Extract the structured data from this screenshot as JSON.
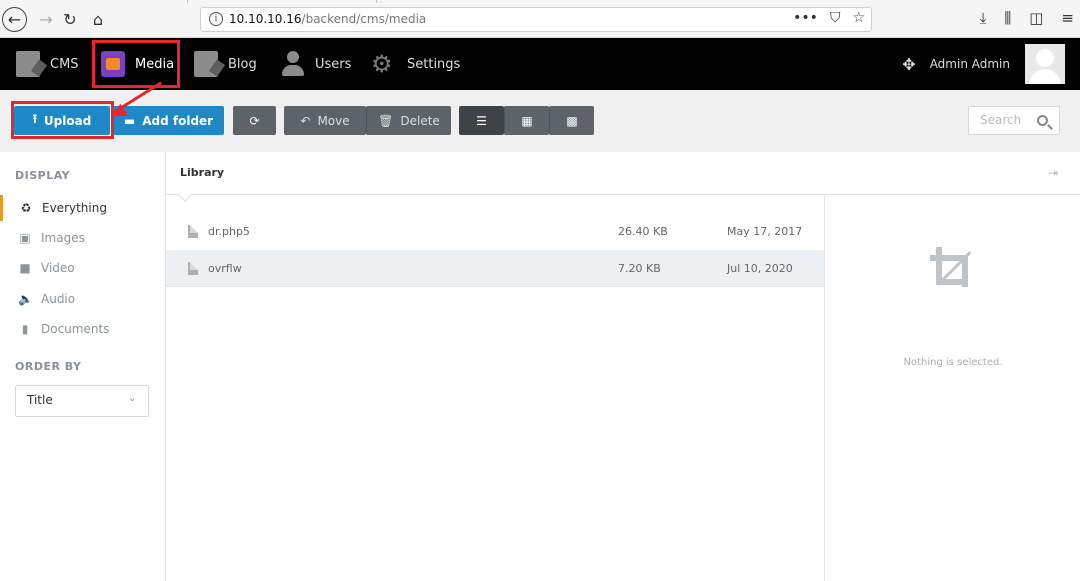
{
  "browser": {
    "url_host": "10.10.10.16",
    "url_path": "/backend/cms/media",
    "url_more_icon": "•••"
  },
  "nav": {
    "items": [
      {
        "label": "CMS",
        "icon": "cms-icon"
      },
      {
        "label": "Media",
        "icon": "media-icon"
      },
      {
        "label": "Blog",
        "icon": "blog-icon"
      },
      {
        "label": "Users",
        "icon": "users-icon"
      },
      {
        "label": "Settings",
        "icon": "settings-icon"
      }
    ],
    "user_name": "Admin Admin"
  },
  "toolbar": {
    "upload_label": "Upload",
    "add_folder_label": "Add folder",
    "move_label": "Move",
    "delete_label": "Delete",
    "search_placeholder": "Search"
  },
  "sidebar": {
    "display_heading": "DISPLAY",
    "items": [
      {
        "label": "Everything",
        "active": true
      },
      {
        "label": "Images"
      },
      {
        "label": "Video"
      },
      {
        "label": "Audio"
      },
      {
        "label": "Documents"
      }
    ],
    "order_heading": "ORDER BY",
    "order_value": "Title"
  },
  "library": {
    "title": "Library",
    "files": [
      {
        "name": "dr.php5",
        "size": "26.40 KB",
        "date": "May 17, 2017"
      },
      {
        "name": "ovrflw",
        "size": "7.20 KB",
        "date": "Jul 10, 2020"
      }
    ],
    "empty_text": "Nothing is selected."
  },
  "colors": {
    "primary_button": "#1f88c7",
    "highlight_annotation": "#e8252d",
    "active_accent": "#e49b2a",
    "topbar": "#000000"
  }
}
